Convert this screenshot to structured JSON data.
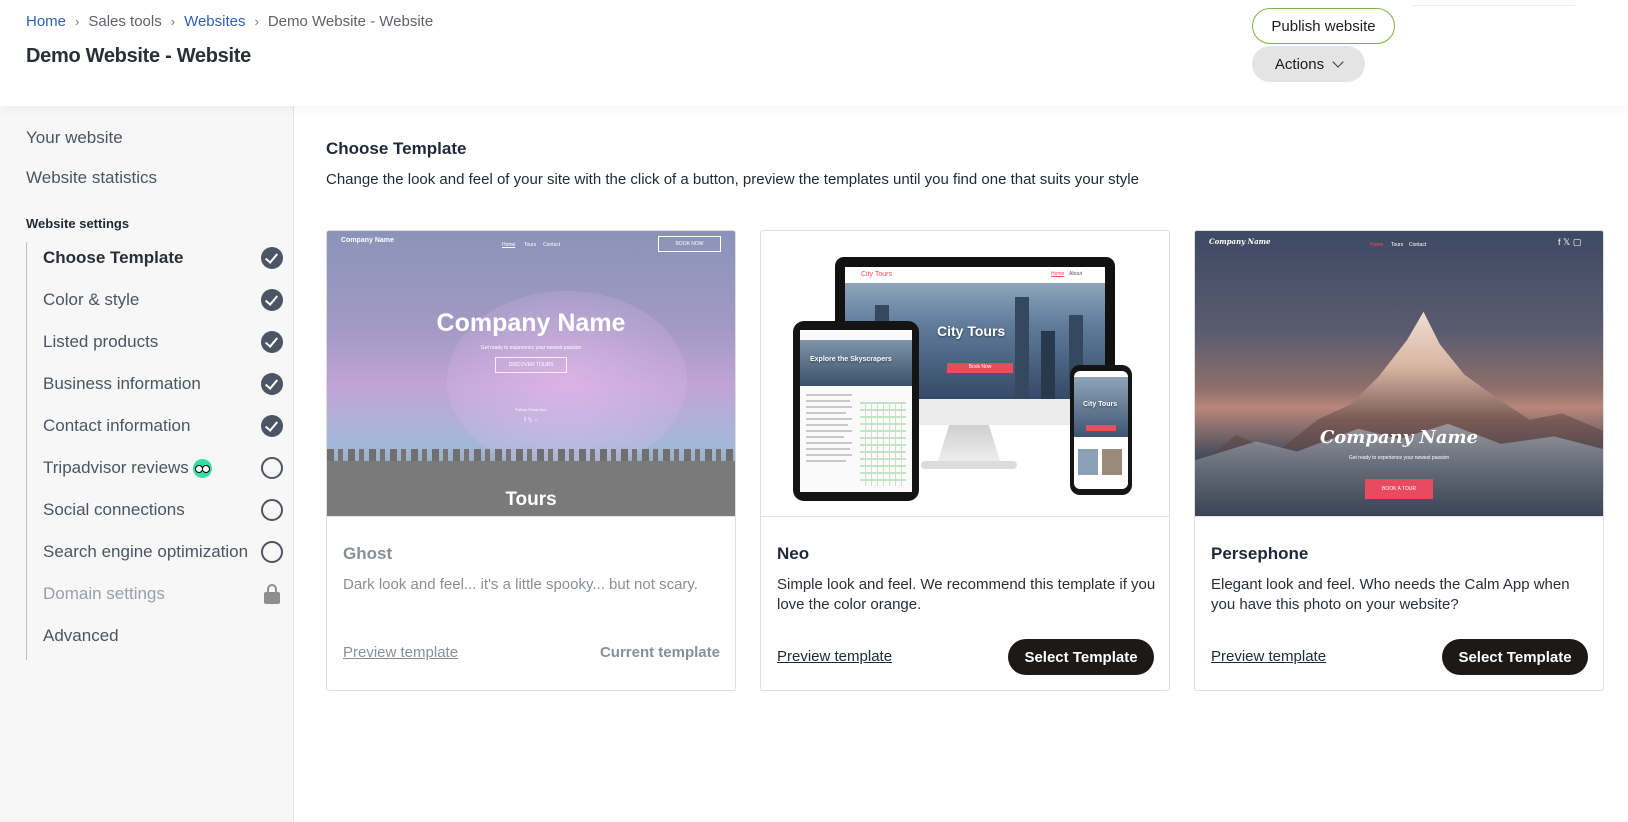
{
  "breadcrumb": {
    "home": "Home",
    "sales_tools": "Sales tools",
    "websites": "Websites",
    "current": "Demo Website - Website",
    "sep": "›"
  },
  "page_title": "Demo Website - Website",
  "header": {
    "publish_label": "Publish website",
    "actions_label": "Actions"
  },
  "sidebar": {
    "your_website": "Your website",
    "website_statistics": "Website statistics",
    "section_title": "Website settings",
    "items": [
      {
        "label": "Choose Template",
        "status": "done"
      },
      {
        "label": "Color & style",
        "status": "done"
      },
      {
        "label": "Listed products",
        "status": "done"
      },
      {
        "label": "Business information",
        "status": "done"
      },
      {
        "label": "Contact information",
        "status": "done"
      },
      {
        "label": "Tripadvisor reviews",
        "status": "todo"
      },
      {
        "label": "Social connections",
        "status": "todo"
      },
      {
        "label": "Search engine optimization",
        "status": "todo"
      },
      {
        "label": "Domain settings",
        "status": "locked"
      },
      {
        "label": "Advanced",
        "status": "none"
      }
    ]
  },
  "main": {
    "title": "Choose Template",
    "description": "Change the look and feel of your site with the click of a button, preview the templates until you find one that suits your style"
  },
  "templates": [
    {
      "name": "Ghost",
      "description": "Dark look and feel... it's a little spooky... but not scary.",
      "preview_label": "Preview template",
      "status_label": "Current template",
      "thumb": {
        "company_small": "Company Name",
        "nav_home": "Home",
        "nav_tours": "Tours",
        "nav_contact": "Contact",
        "book_now": "BOOK NOW",
        "hero": "Company Name",
        "tagline": "Get ready to experience your newest passion",
        "cta": "DISCOVER TOURS",
        "follow": "Follow Ghost Inc!",
        "section": "Tours"
      }
    },
    {
      "name": "Neo",
      "description": "Simple look and feel. We recommend this template if you love the color orange.",
      "preview_label": "Preview template",
      "select_label": "Select Template",
      "thumb": {
        "monitor_title": "City Tours",
        "tablet_title": "Explore the Skyscrapers",
        "phone_title": "City Tours",
        "nav_brand": "City Tours",
        "nav_home": "Home",
        "nav_about": "About",
        "book_now": "Book Now"
      }
    },
    {
      "name": "Persephone",
      "description": "Elegant look and feel. Who needs the Calm App when you have this photo on your website?",
      "preview_label": "Preview template",
      "select_label": "Select Template",
      "thumb": {
        "company_small": "Company Name",
        "nav_home": "Home",
        "nav_tours": "Tours",
        "nav_contact": "Contact",
        "hero": "Company Name",
        "tagline": "Get ready to experience your newest passion",
        "cta": "BOOK A TOUR"
      }
    }
  ],
  "colors": {
    "accent_green": "#7cb342",
    "link_blue": "#2c5fb8",
    "select_button": "#1c1a18",
    "tripadvisor": "#34e0a1"
  }
}
